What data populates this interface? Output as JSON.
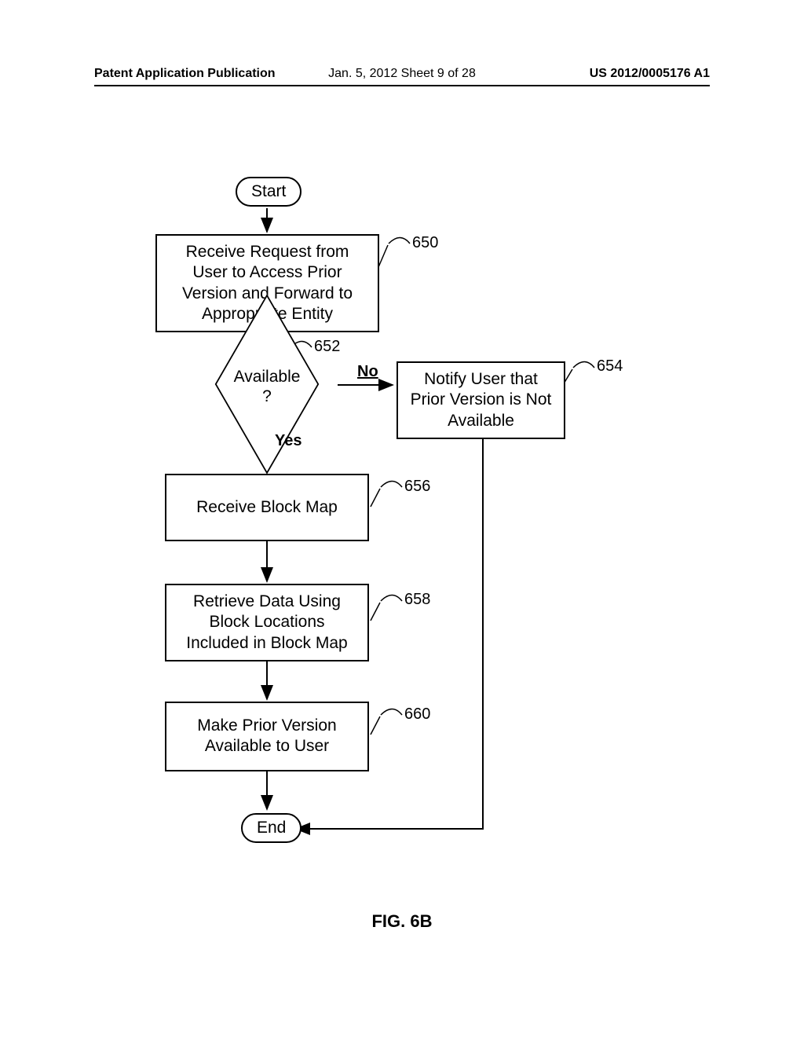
{
  "header": {
    "left": "Patent Application Publication",
    "center": "Jan. 5, 2012  Sheet 9 of 28",
    "right": "US 2012/0005176 A1"
  },
  "nodes": {
    "start": "Start",
    "step650": "Receive Request from User to Access Prior Version and Forward to Appropriate Entity",
    "decision652": "Available\n?",
    "step654": "Notify User that Prior Version is Not Available",
    "step656": "Receive Block Map",
    "step658": "Retrieve Data Using Block Locations Included in Block Map",
    "step660": "Make Prior Version Available to User",
    "end": "End"
  },
  "refs": {
    "r650": "650",
    "r652": "652",
    "r654": "654",
    "r656": "656",
    "r658": "658",
    "r660": "660"
  },
  "branches": {
    "no": "No",
    "yes": "Yes"
  },
  "figure": "FIG. 6B"
}
